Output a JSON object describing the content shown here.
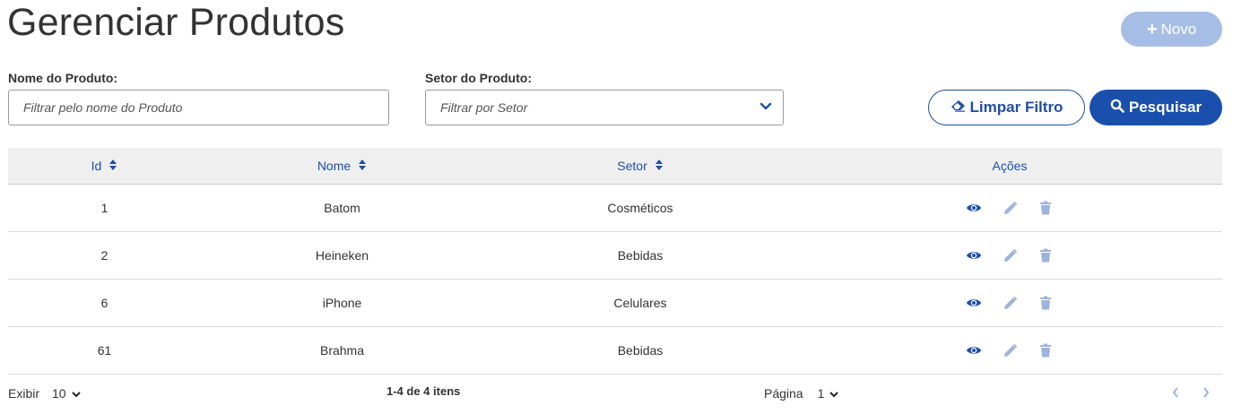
{
  "header": {
    "title": "Gerenciar Produtos",
    "new_button": "Novo"
  },
  "filters": {
    "nome_label": "Nome do Produto:",
    "nome_placeholder": "Filtrar pelo nome do Produto",
    "setor_label": "Setor do Produto:",
    "setor_placeholder": "Filtrar por Setor",
    "clear_button": "Limpar Filtro",
    "search_button": "Pesquisar"
  },
  "table": {
    "columns": [
      "Id",
      "Nome",
      "Setor",
      "Ações"
    ],
    "rows": [
      {
        "id": "1",
        "nome": "Batom",
        "setor": "Cosméticos"
      },
      {
        "id": "2",
        "nome": "Heineken",
        "setor": "Bebidas"
      },
      {
        "id": "6",
        "nome": "iPhone",
        "setor": "Celulares"
      },
      {
        "id": "61",
        "nome": "Brahma",
        "setor": "Bebidas"
      }
    ]
  },
  "footer": {
    "show_label": "Exibir",
    "page_size": "10",
    "range_text": "1-4 de 4 itens",
    "page_label": "Página",
    "page_value": "1"
  },
  "colors": {
    "primary": "#1b4fae",
    "primary_light": "#a6bee6",
    "action_muted": "#9db4dd",
    "header_bg": "#efefef"
  }
}
